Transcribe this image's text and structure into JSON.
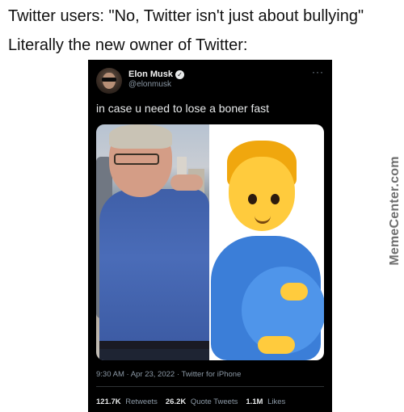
{
  "captions": {
    "line1": "Twitter users: \"No, Twitter isn't just about bullying\"",
    "line2": "Literally the new owner of Twitter:"
  },
  "tweet": {
    "display_name": "Elon Musk",
    "verified_icon": "verified-badge-icon",
    "handle": "@elonmusk",
    "more_icon": "more-options-icon",
    "text": "in case u need to lose a boner fast",
    "meta": "9:30 AM · Apr 23, 2022 · Twitter for iPhone",
    "stats": [
      {
        "count": "121.7K",
        "label": "Retweets"
      },
      {
        "count": "26.2K",
        "label": "Quote Tweets"
      },
      {
        "count": "1.1M",
        "label": "Likes"
      }
    ]
  },
  "watermark": "MemeCenter.com",
  "colors": {
    "tweet_background": "#000000",
    "muted_text": "#8b98a5",
    "emoji_shirt": "#3b7ed8"
  }
}
